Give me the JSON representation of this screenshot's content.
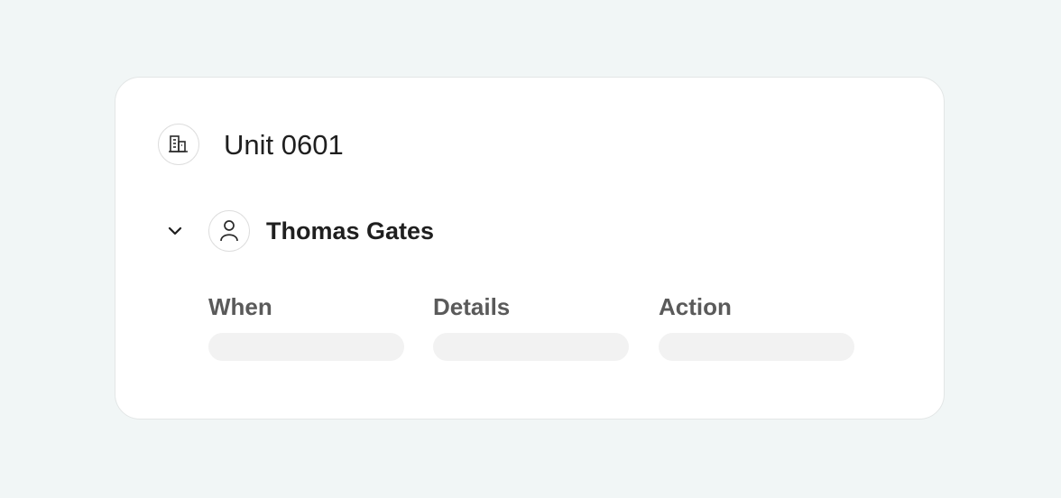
{
  "unit": {
    "title": "Unit 0601",
    "icon": "building-icon"
  },
  "person": {
    "name": "Thomas Gates",
    "icon": "user-icon",
    "expand_icon": "chevron-down-icon"
  },
  "table": {
    "columns": [
      "When",
      "Details",
      "Action"
    ]
  },
  "colors": {
    "background": "#f1f6f6",
    "card": "#ffffff",
    "skeleton": "#f2f2f2",
    "header_text": "#5a5a5a",
    "primary_text": "#1f1f1f"
  }
}
